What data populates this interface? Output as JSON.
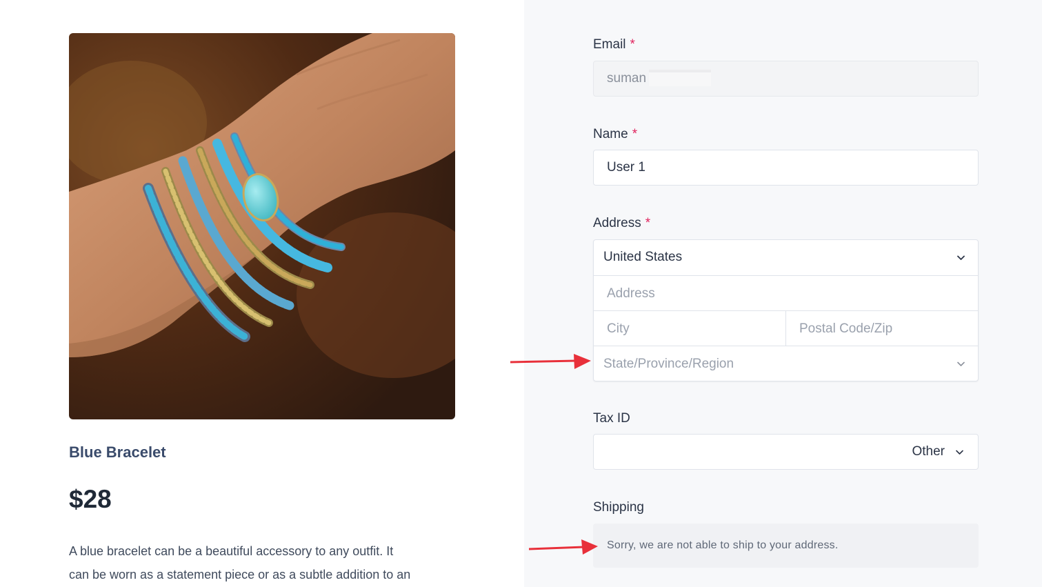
{
  "product": {
    "name": "Blue Bracelet",
    "price": "$28",
    "description_line1": "A blue bracelet can be a beautiful accessory to any outfit. It",
    "description_line2": "can be worn as a statement piece or as a subtle addition to an"
  },
  "form": {
    "email": {
      "label": "Email",
      "required": "*",
      "value": "suman"
    },
    "name": {
      "label": "Name",
      "required": "*",
      "value": "User 1"
    },
    "address": {
      "label": "Address",
      "required": "*",
      "country": "United States",
      "address_placeholder": "Address",
      "city_placeholder": "City",
      "zip_placeholder": "Postal Code/Zip",
      "state_placeholder": "State/Province/Region"
    },
    "tax_id": {
      "label": "Tax ID",
      "type": "Other"
    },
    "shipping": {
      "label": "Shipping",
      "message": "Sorry, we are not able to ship to your address."
    }
  },
  "colors": {
    "annotation_arrow": "#e8303a",
    "required_star": "#e0245e",
    "right_panel_bg": "#f7f8fa"
  }
}
